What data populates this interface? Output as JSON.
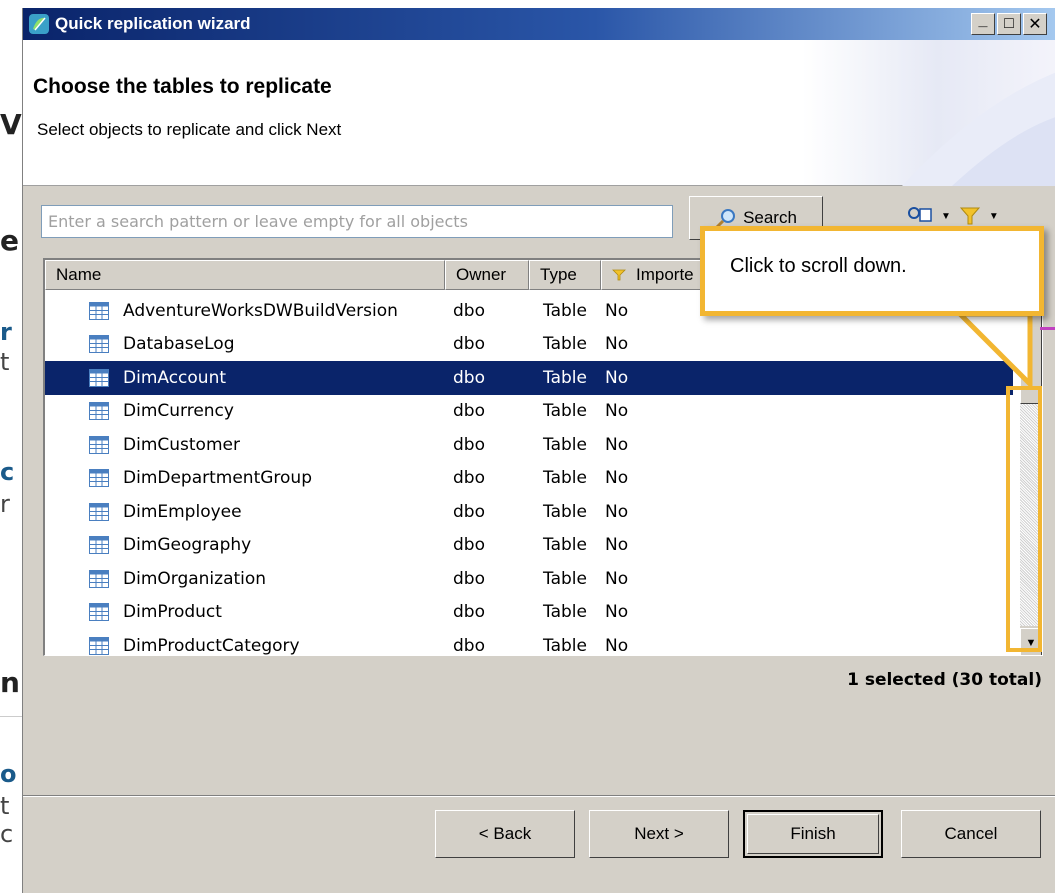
{
  "background_page": {
    "fragments": [
      "V",
      "e",
      "r",
      "t",
      "c",
      "r",
      "n",
      "o",
      "t",
      "c"
    ]
  },
  "window": {
    "title": "Quick replication wizard",
    "buttons": {
      "minimize": "_",
      "maximize": "□",
      "close": "✕"
    }
  },
  "header": {
    "title": "Choose the tables to replicate",
    "subtitle": "Select objects to replicate and click Next"
  },
  "search": {
    "placeholder": "Enter a search pattern or leave empty for all objects",
    "value": "",
    "button_label": "Search"
  },
  "table": {
    "columns": [
      "Name",
      "Owner",
      "Type",
      "Importe"
    ],
    "rows": [
      {
        "name": "AdventureWorksDWBuildVersion",
        "owner": "dbo",
        "type": "Table",
        "imported": "No",
        "selected": false
      },
      {
        "name": "DatabaseLog",
        "owner": "dbo",
        "type": "Table",
        "imported": "No",
        "selected": false
      },
      {
        "name": "DimAccount",
        "owner": "dbo",
        "type": "Table",
        "imported": "No",
        "selected": true
      },
      {
        "name": "DimCurrency",
        "owner": "dbo",
        "type": "Table",
        "imported": "No",
        "selected": false
      },
      {
        "name": "DimCustomer",
        "owner": "dbo",
        "type": "Table",
        "imported": "No",
        "selected": false
      },
      {
        "name": "DimDepartmentGroup",
        "owner": "dbo",
        "type": "Table",
        "imported": "No",
        "selected": false
      },
      {
        "name": "DimEmployee",
        "owner": "dbo",
        "type": "Table",
        "imported": "No",
        "selected": false
      },
      {
        "name": "DimGeography",
        "owner": "dbo",
        "type": "Table",
        "imported": "No",
        "selected": false
      },
      {
        "name": "DimOrganization",
        "owner": "dbo",
        "type": "Table",
        "imported": "No",
        "selected": false
      },
      {
        "name": "DimProduct",
        "owner": "dbo",
        "type": "Table",
        "imported": "No",
        "selected": false
      },
      {
        "name": "DimProductCategory",
        "owner": "dbo",
        "type": "Table",
        "imported": "No",
        "selected": false
      }
    ]
  },
  "status": "1 selected (30 total)",
  "buttons": {
    "back": "< Back",
    "next": "Next >",
    "finish": "Finish",
    "cancel": "Cancel"
  },
  "callout": {
    "text": "Click to scroll down."
  },
  "colors": {
    "accent": "#0a246a",
    "callout_border": "#f2b632",
    "dialog_bg": "#d4d0c8"
  }
}
